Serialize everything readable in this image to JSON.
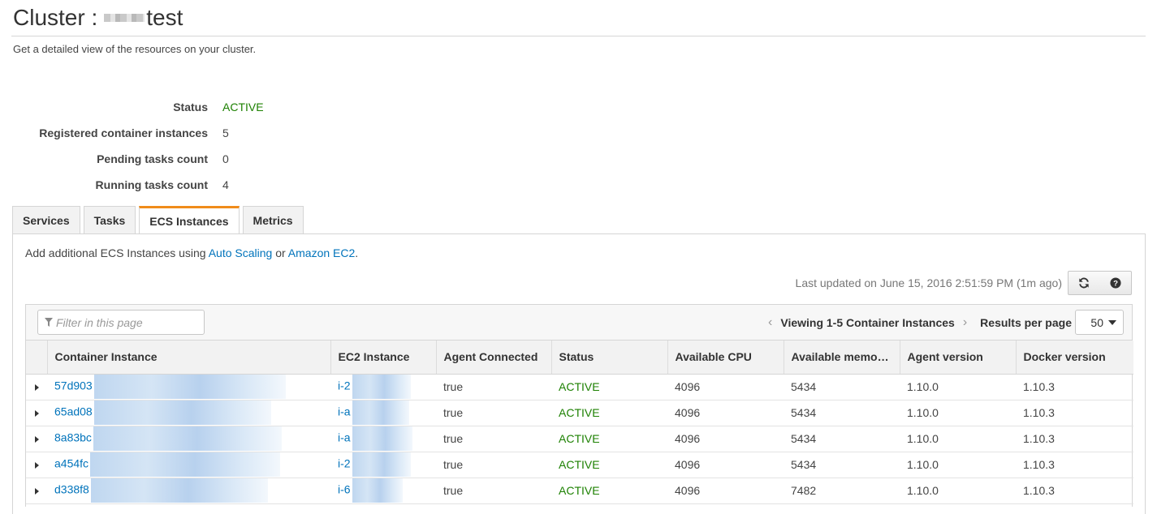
{
  "page": {
    "title_prefix": "Cluster :",
    "title_suffix": "test",
    "subtitle": "Get a detailed view of the resources on your cluster."
  },
  "summary": [
    {
      "label": "Status",
      "value": "ACTIVE"
    },
    {
      "label": "Registered container instances",
      "value": "5"
    },
    {
      "label": "Pending tasks count",
      "value": "0"
    },
    {
      "label": "Running tasks count",
      "value": "4"
    }
  ],
  "tabs": [
    {
      "label": "Services",
      "selected": false
    },
    {
      "label": "Tasks",
      "selected": false
    },
    {
      "label": "ECS Instances",
      "selected": true
    },
    {
      "label": "Metrics",
      "selected": false
    }
  ],
  "hint": {
    "prefix": "Add additional ECS Instances using",
    "link1": "Auto Scaling",
    "middle": "or",
    "link2": "Amazon EC2",
    "suffix": "."
  },
  "last_updated": "Last updated on June 15, 2016 2:51:59 PM (1m ago)",
  "filter": {
    "placeholder": "Filter in this page"
  },
  "pager": {
    "viewing": "Viewing 1-5 Container Instances",
    "results_label": "Results per page",
    "results_value": "50"
  },
  "columns": [
    "Container Instance",
    "EC2 Instance",
    "Agent Connected",
    "Status",
    "Available CPU",
    "Available memor…",
    "Agent version",
    "Docker version"
  ],
  "rows": [
    {
      "container": "57d903",
      "ec2": "i-2",
      "agent_connected": "true",
      "status": "ACTIVE",
      "cpu": "4096",
      "memory": "5434",
      "agent_version": "1.10.0",
      "docker_version": "1.10.3"
    },
    {
      "container": "65ad08",
      "ec2": "i-a",
      "agent_connected": "true",
      "status": "ACTIVE",
      "cpu": "4096",
      "memory": "5434",
      "agent_version": "1.10.0",
      "docker_version": "1.10.3"
    },
    {
      "container": "8a83bc",
      "ec2": "i-a",
      "agent_connected": "true",
      "status": "ACTIVE",
      "cpu": "4096",
      "memory": "5434",
      "agent_version": "1.10.0",
      "docker_version": "1.10.3"
    },
    {
      "container": "a454fc",
      "ec2": "i-2",
      "agent_connected": "true",
      "status": "ACTIVE",
      "cpu": "4096",
      "memory": "5434",
      "agent_version": "1.10.0",
      "docker_version": "1.10.3"
    },
    {
      "container": "d338f8",
      "ec2": "i-6",
      "agent_connected": "true",
      "status": "ACTIVE",
      "cpu": "4096",
      "memory": "7482",
      "agent_version": "1.10.0",
      "docker_version": "1.10.3"
    }
  ],
  "colors": {
    "link": "#0073bb",
    "active": "#1d8102",
    "tab_accent": "#f08c1a"
  },
  "icons": {
    "refresh": "refresh-icon",
    "help": "help-icon",
    "filter": "filter-icon",
    "expand": "expand-triangle-icon"
  }
}
